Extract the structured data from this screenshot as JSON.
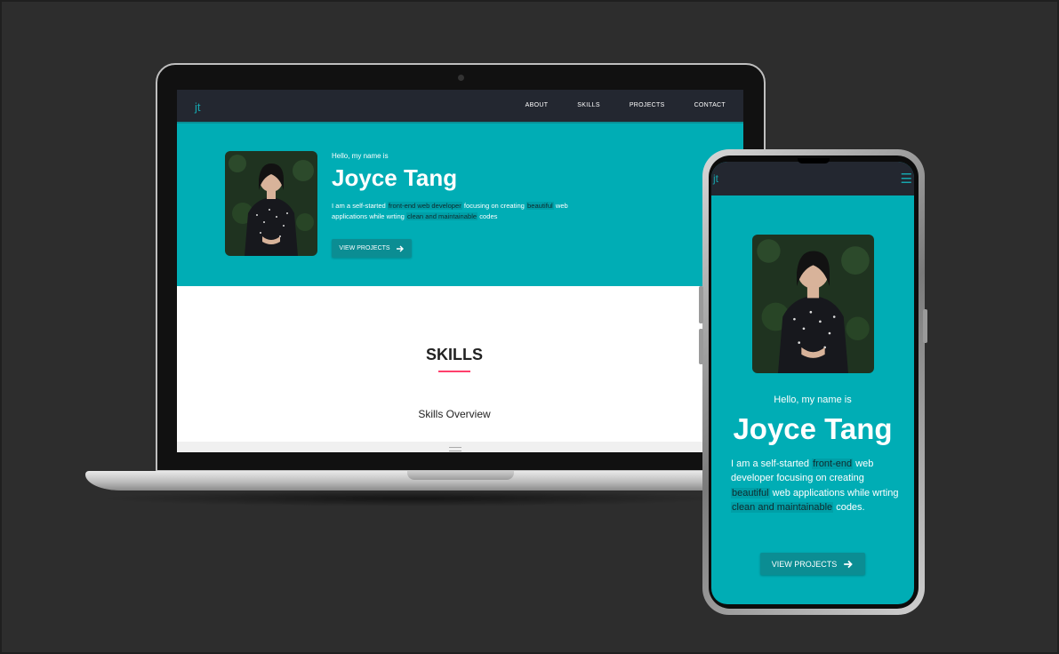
{
  "site": {
    "logo": "jt",
    "nav": [
      "ABOUT",
      "SKILLS",
      "PROJECTS",
      "CONTACT"
    ],
    "hero": {
      "greeting": "Hello, my name is",
      "name": "Joyce Tang",
      "desc_parts": [
        {
          "text": "I am a self-started ",
          "hl": false
        },
        {
          "text": "front-end web developer",
          "hl": true
        },
        {
          "text": " ",
          "hl": false
        },
        {
          "text": "focusing on creating",
          "hl": false
        },
        {
          "text": " ",
          "hl": false
        },
        {
          "text": "beautiful",
          "hl": true
        },
        {
          "text": " web applications while wrting ",
          "hl": false
        },
        {
          "text": "clean and maintainable",
          "hl": true
        },
        {
          "text": " codes",
          "hl": false
        }
      ],
      "button_label": "VIEW PROJECTS"
    },
    "skills": {
      "title": "SKILLS",
      "subtitle": "Skills Overview"
    }
  },
  "mobile": {
    "desc_parts": [
      {
        "text": "I am a self-started ",
        "hl": false
      },
      {
        "text": "front-end",
        "hl": true
      },
      {
        "text": " web developer ",
        "hl": false
      },
      {
        "text": "focusing on creating",
        "hl": false
      },
      {
        "text": " ",
        "hl": false
      },
      {
        "text": "beautiful",
        "hl": true
      },
      {
        "text": " web applications while wrting ",
        "hl": false
      },
      {
        "text": "clean and maintainable",
        "hl": true
      },
      {
        "text": " codes.",
        "hl": false
      }
    ],
    "menu_icon": "hamburger-icon"
  },
  "colors": {
    "background": "#2d2d2d",
    "nav": "#232730",
    "accent": "#00adb5",
    "button": "#0b8d93",
    "underline": "#ff3f6c"
  }
}
